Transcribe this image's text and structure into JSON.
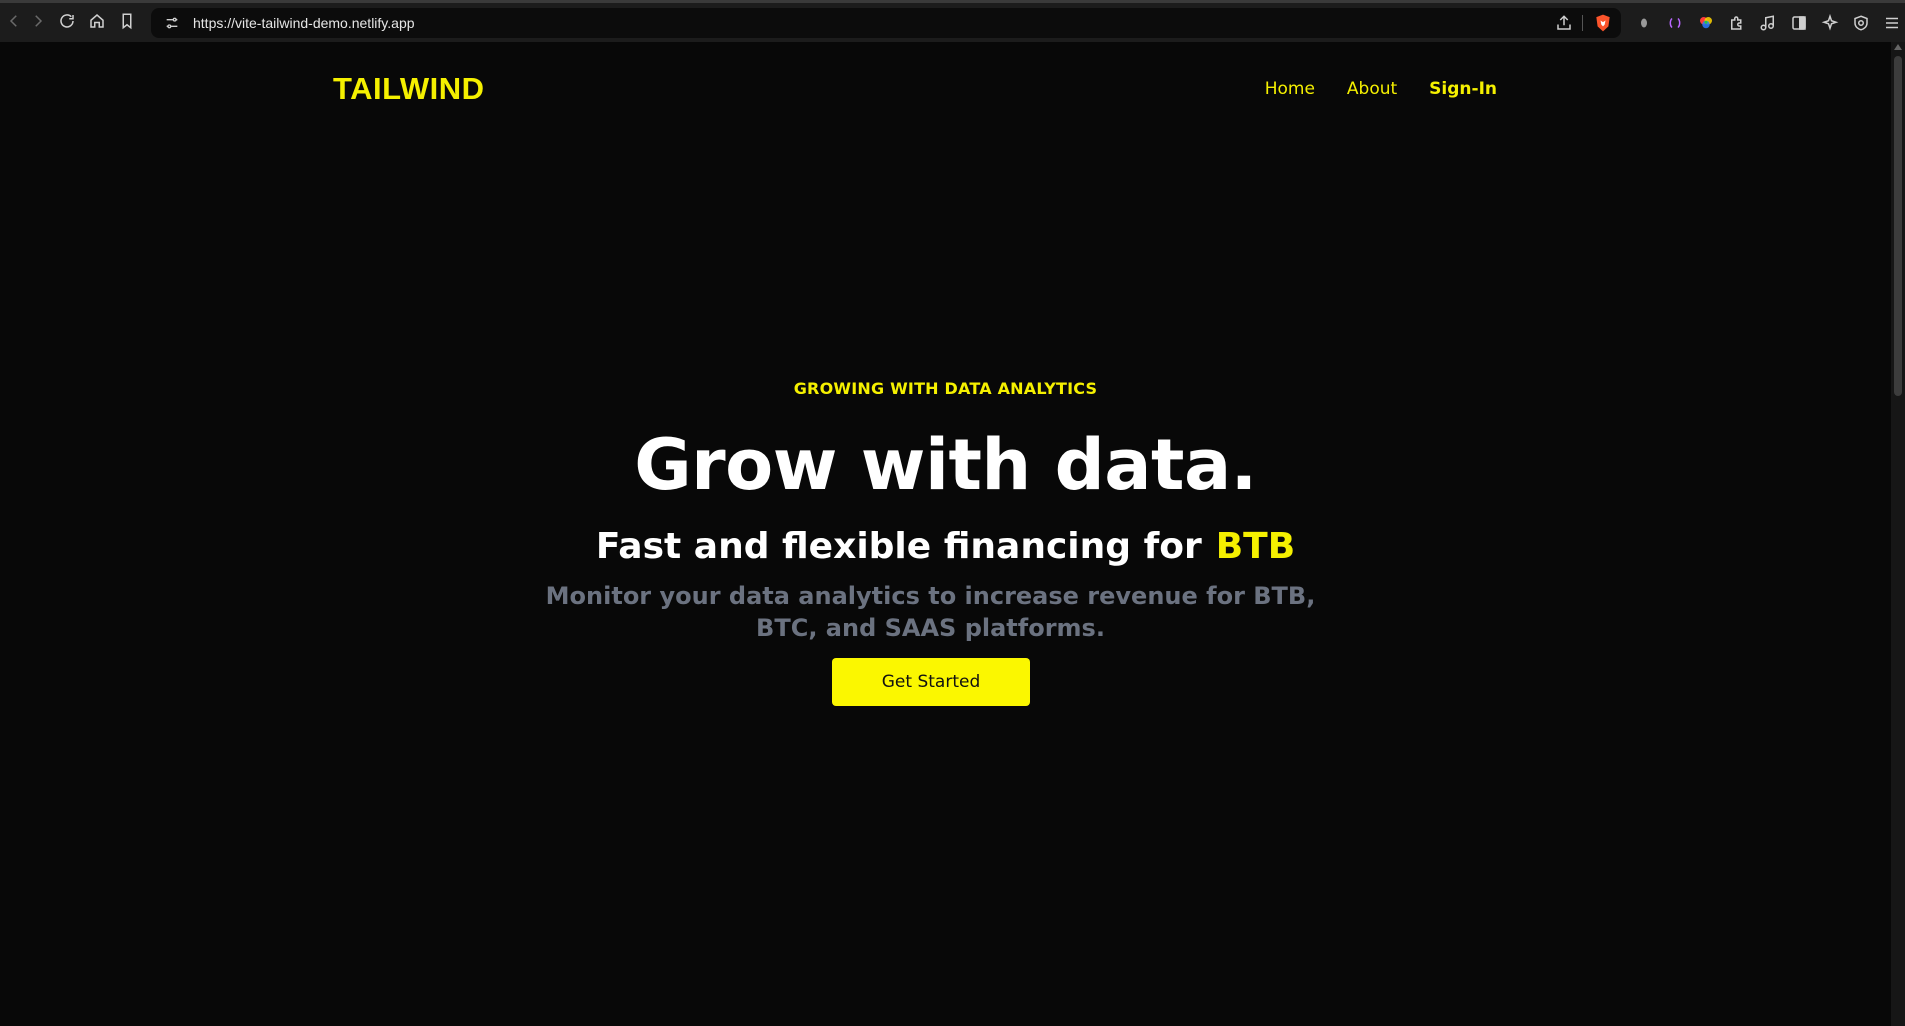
{
  "browser": {
    "url": "https://vite-tailwind-demo.netlify.app",
    "icons": {
      "back": "chevron-left-icon",
      "forward": "chevron-right-icon",
      "reload": "reload-icon",
      "home": "home-icon",
      "bookmark": "bookmark-icon",
      "site_settings": "tune-icon",
      "share": "share-icon",
      "brave_shields": "brave-shield-icon",
      "extensions": [
        "extension-1-icon",
        "extension-2-icon",
        "color-picker-icon",
        "puzzle-icon",
        "music-icon",
        "sidebar-icon",
        "leo-ai-icon",
        "vpn-shield-icon",
        "menu-icon"
      ]
    }
  },
  "site": {
    "logo": "TAILWIND",
    "nav": {
      "home": "Home",
      "about": "About",
      "signin": "Sign-In"
    }
  },
  "hero": {
    "eyebrow": "GROWING WITH DATA ANALYTICS",
    "headline": "Grow with data.",
    "subhead_prefix": "Fast and flexible financing for",
    "subhead_accent": "BTB",
    "description": "Monitor your data analytics to increase revenue for BTB, BTC, and SAAS platforms.",
    "cta_label": "Get Started"
  },
  "colors": {
    "accent": "#f5f000",
    "background": "#080808",
    "muted_text": "#6b7280"
  }
}
